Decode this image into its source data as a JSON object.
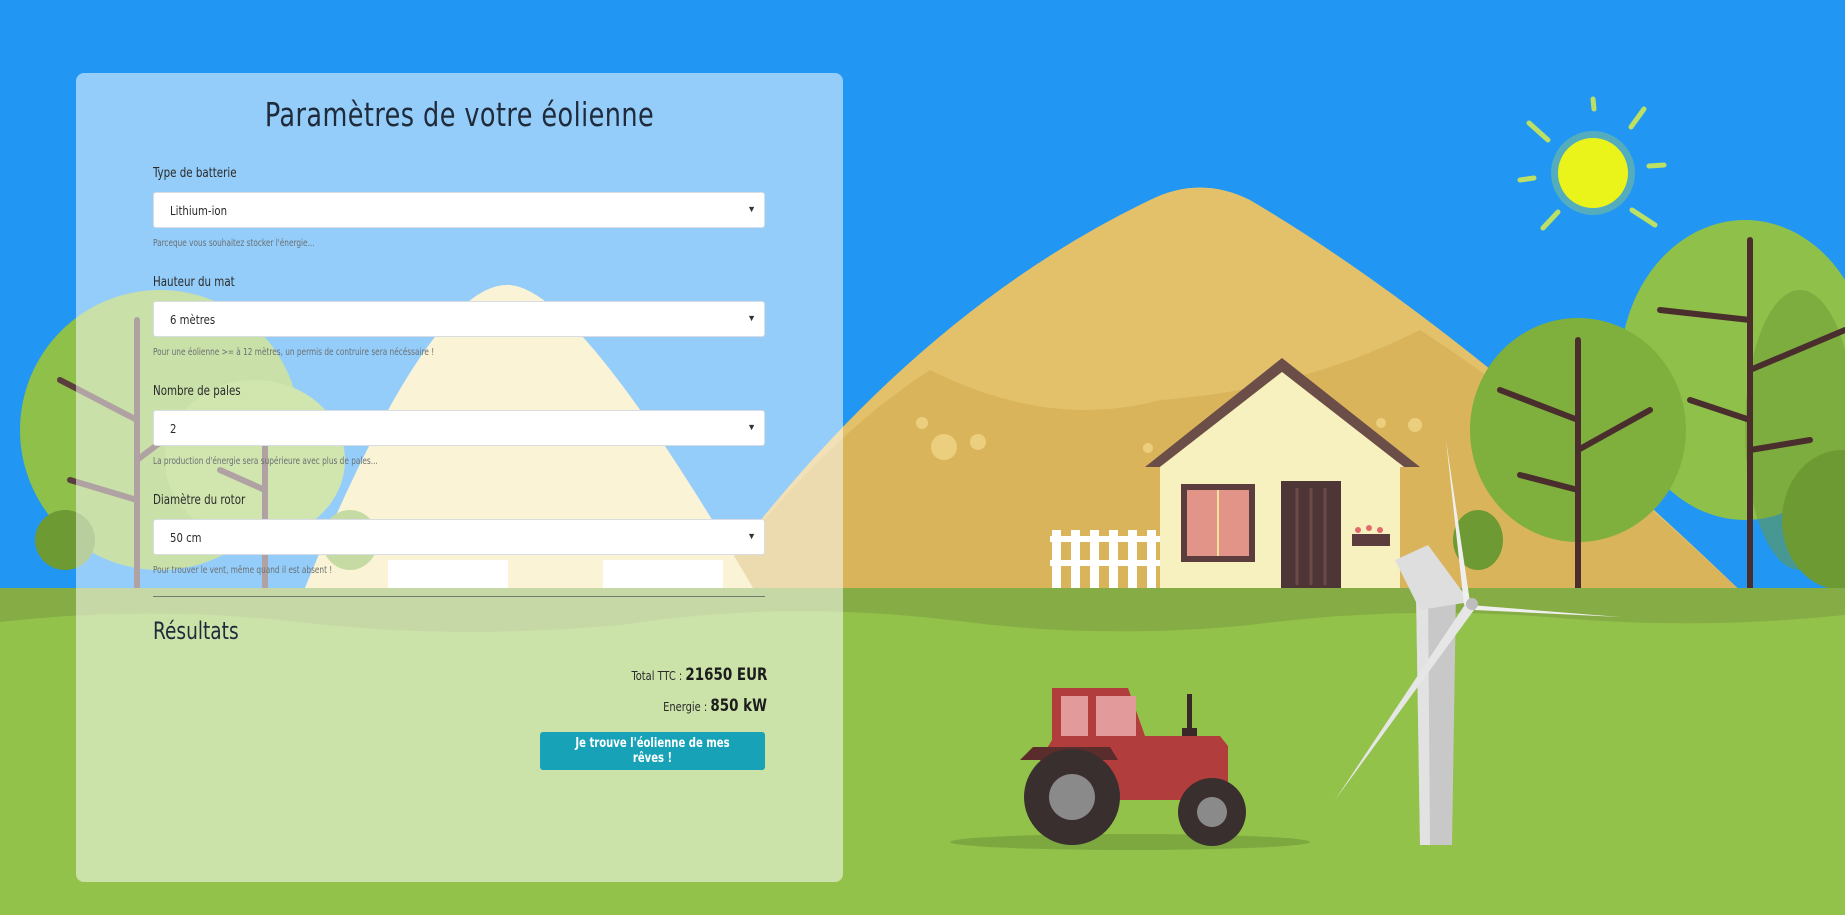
{
  "form": {
    "title": "Paramètres de votre éolienne",
    "fields": [
      {
        "label": "Type de batterie",
        "value": "Lithium-ion",
        "help": "Parceque vous souhaitez stocker l'énergie..."
      },
      {
        "label": "Hauteur du mat",
        "value": "6 mètres",
        "help": "Pour une éolienne >= à 12 mètres, un permis de contruire sera nécéssaire !"
      },
      {
        "label": "Nombre de pales",
        "value": "2",
        "help": "La production d'énergie sera supérieure avec plus de pales..."
      },
      {
        "label": "Diamètre du rotor",
        "value": "50 cm",
        "help": "Pour trouver le vent, même quand il est absent !"
      }
    ]
  },
  "results": {
    "title": "Résultats",
    "total_label": "Total TTC : ",
    "total_value": "21650 EUR",
    "energy_label": "Energie : ",
    "energy_value": "850 kW",
    "cta_label": "Je trouve l'éolienne de mes rêves !"
  },
  "colors": {
    "sky": "#2196f3",
    "grass": "#93c24b",
    "hill": "#e3c16a",
    "cta": "#17a2b8",
    "tractor": "#b13d3d",
    "sun": "#eaf51b"
  },
  "icons": {
    "caret": "caret-down-icon"
  }
}
